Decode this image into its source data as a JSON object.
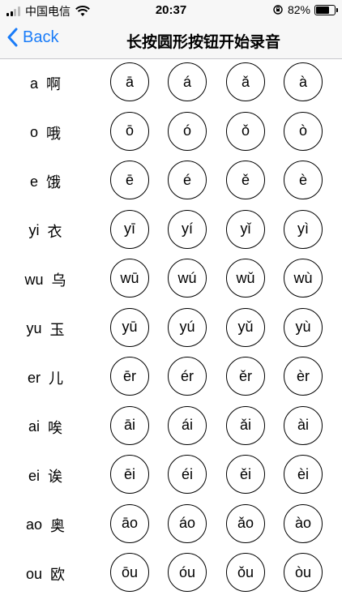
{
  "status_bar": {
    "carrier": "中国电信",
    "time": "20:37",
    "battery": "82%",
    "battery_level": 0.82
  },
  "nav": {
    "back_label": "Back",
    "title": "长按圆形按钮开始录音"
  },
  "rows": [
    {
      "latin": "a",
      "hanzi": "啊",
      "tones": [
        "ā",
        "á",
        "ǎ",
        "à"
      ]
    },
    {
      "latin": "o",
      "hanzi": "哦",
      "tones": [
        "ō",
        "ó",
        "ǒ",
        "ò"
      ]
    },
    {
      "latin": "e",
      "hanzi": "饿",
      "tones": [
        "ē",
        "é",
        "ě",
        "è"
      ]
    },
    {
      "latin": "yi",
      "hanzi": "衣",
      "tones": [
        "yī",
        "yí",
        "yǐ",
        "yì"
      ]
    },
    {
      "latin": "wu",
      "hanzi": "乌",
      "tones": [
        "wū",
        "wú",
        "wǔ",
        "wù"
      ]
    },
    {
      "latin": "yu",
      "hanzi": "玉",
      "tones": [
        "yū",
        "yú",
        "yǔ",
        "yù"
      ]
    },
    {
      "latin": "er",
      "hanzi": "儿",
      "tones": [
        "ēr",
        "ér",
        "ěr",
        "èr"
      ]
    },
    {
      "latin": "ai",
      "hanzi": "唉",
      "tones": [
        "āi",
        "ái",
        "ǎi",
        "ài"
      ]
    },
    {
      "latin": "ei",
      "hanzi": "诶",
      "tones": [
        "ēi",
        "éi",
        "ěi",
        "èi"
      ]
    },
    {
      "latin": "ao",
      "hanzi": "奥",
      "tones": [
        "āo",
        "áo",
        "ǎo",
        "ào"
      ]
    },
    {
      "latin": "ou",
      "hanzi": "欧",
      "tones": [
        "ōu",
        "óu",
        "ǒu",
        "òu"
      ]
    }
  ]
}
